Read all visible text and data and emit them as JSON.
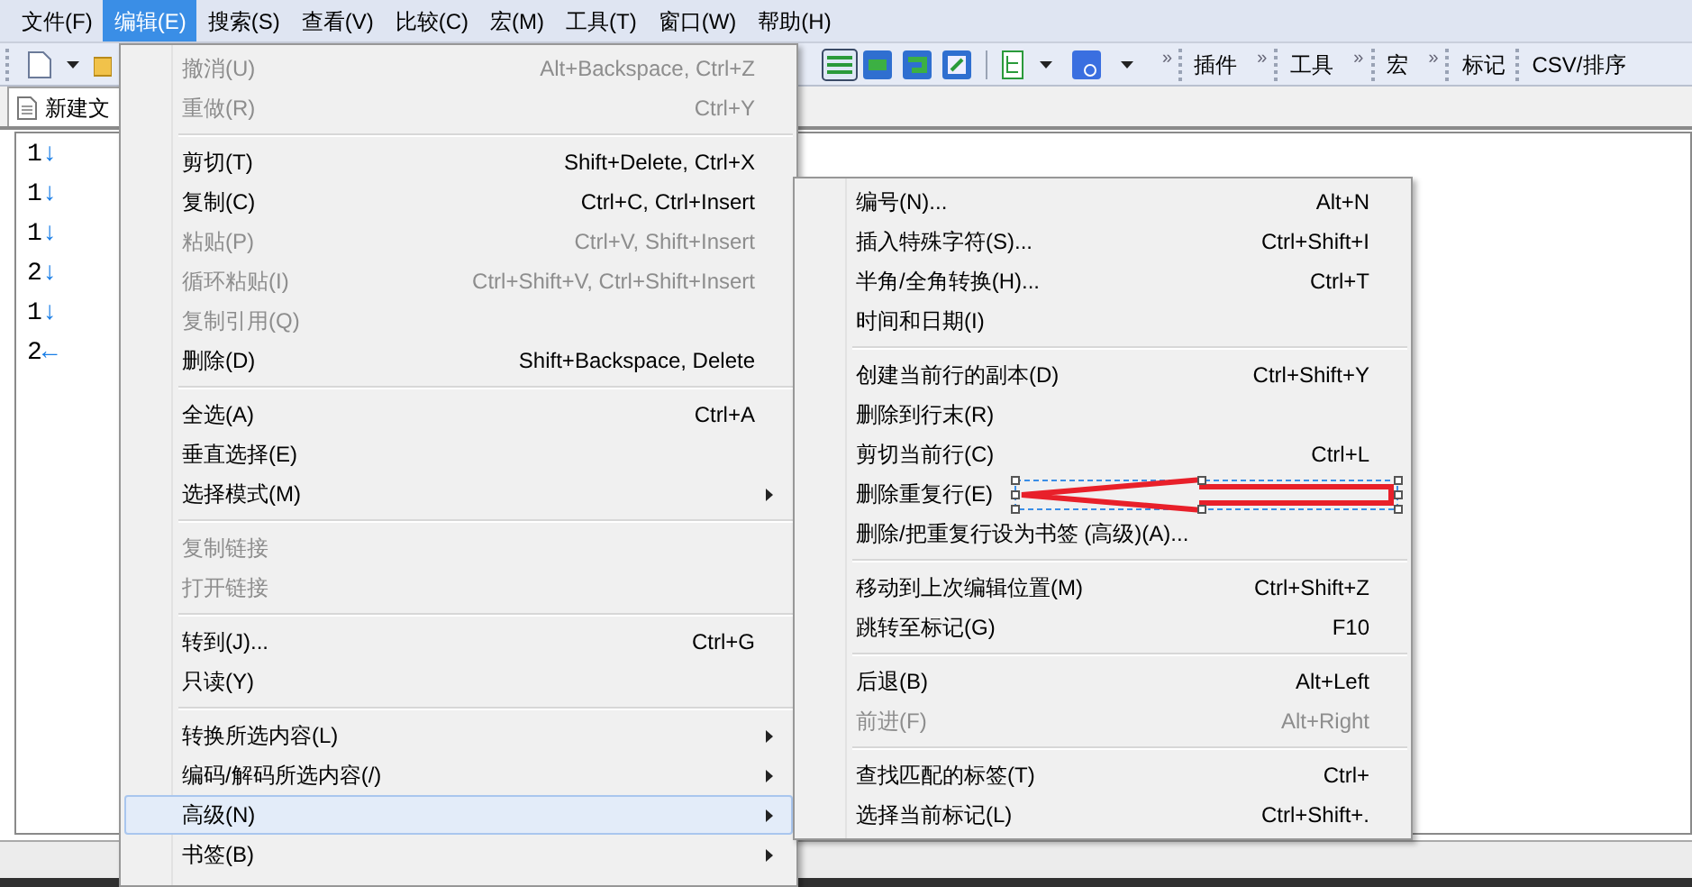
{
  "menubar": [
    {
      "label": "文件(F)",
      "selected": false
    },
    {
      "label": "编辑(E)",
      "selected": true
    },
    {
      "label": "搜索(S)",
      "selected": false
    },
    {
      "label": "查看(V)",
      "selected": false
    },
    {
      "label": "比较(C)",
      "selected": false
    },
    {
      "label": "宏(M)",
      "selected": false
    },
    {
      "label": "工具(T)",
      "selected": false
    },
    {
      "label": "窗口(W)",
      "selected": false
    },
    {
      "label": "帮助(H)",
      "selected": false
    }
  ],
  "toolbar": {
    "chevron": "»",
    "groups": [
      {
        "label": "插件",
        "chevron": "»"
      },
      {
        "label": "工具",
        "chevron": "»"
      },
      {
        "label": "宏",
        "chevron": "»"
      },
      {
        "label": "标记"
      },
      {
        "label": "CSV/排序"
      }
    ]
  },
  "tab": {
    "label": "新建文"
  },
  "editor_lines": [
    {
      "number": "1",
      "mark": "↓"
    },
    {
      "number": "1",
      "mark": "↓"
    },
    {
      "number": "1",
      "mark": "↓"
    },
    {
      "number": "2",
      "mark": "↓"
    },
    {
      "number": "1",
      "mark": "↓"
    },
    {
      "number": "2",
      "mark": "←"
    }
  ],
  "edit_menu": {
    "sections": [
      [
        {
          "label": "撤消(U)",
          "shortcut": "Alt+Backspace, Ctrl+Z",
          "disabled": true,
          "submenu": false,
          "selected": false
        },
        {
          "label": "重做(R)",
          "shortcut": "Ctrl+Y",
          "disabled": true,
          "submenu": false,
          "selected": false
        }
      ],
      [
        {
          "label": "剪切(T)",
          "shortcut": "Shift+Delete, Ctrl+X",
          "disabled": false,
          "submenu": false,
          "selected": false
        },
        {
          "label": "复制(C)",
          "shortcut": "Ctrl+C, Ctrl+Insert",
          "disabled": false,
          "submenu": false,
          "selected": false
        },
        {
          "label": "粘贴(P)",
          "shortcut": "Ctrl+V, Shift+Insert",
          "disabled": true,
          "submenu": false,
          "selected": false
        },
        {
          "label": "循环粘贴(I)",
          "shortcut": "Ctrl+Shift+V, Ctrl+Shift+Insert",
          "disabled": true,
          "submenu": false,
          "selected": false
        },
        {
          "label": "复制引用(Q)",
          "disabled": true,
          "submenu": false,
          "selected": false
        },
        {
          "label": "删除(D)",
          "shortcut": "Shift+Backspace, Delete",
          "disabled": false,
          "submenu": false,
          "selected": false
        }
      ],
      [
        {
          "label": "全选(A)",
          "shortcut": "Ctrl+A",
          "disabled": false,
          "submenu": false,
          "selected": false
        },
        {
          "label": "垂直选择(E)",
          "disabled": false,
          "submenu": false,
          "selected": false
        },
        {
          "label": "选择模式(M)",
          "disabled": false,
          "submenu": true,
          "selected": false
        }
      ],
      [
        {
          "label": "复制链接",
          "disabled": true,
          "submenu": false,
          "selected": false
        },
        {
          "label": "打开链接",
          "disabled": true,
          "submenu": false,
          "selected": false
        }
      ],
      [
        {
          "label": "转到(J)...",
          "shortcut": "Ctrl+G",
          "disabled": false,
          "submenu": false,
          "selected": false
        },
        {
          "label": "只读(Y)",
          "disabled": false,
          "submenu": false,
          "selected": false
        }
      ],
      [
        {
          "label": "转换所选内容(L)",
          "disabled": false,
          "submenu": true,
          "selected": false
        },
        {
          "label": "编码/解码所选内容(/)",
          "disabled": false,
          "submenu": true,
          "selected": false
        },
        {
          "label": "高级(N)",
          "disabled": false,
          "submenu": true,
          "selected": true
        },
        {
          "label": "书签(B)",
          "disabled": false,
          "submenu": true,
          "selected": false
        }
      ]
    ]
  },
  "advanced_menu": {
    "sections": [
      [
        {
          "label": "编号(N)...",
          "shortcut": "Alt+N",
          "disabled": false
        },
        {
          "label": "插入特殊字符(S)...",
          "shortcut": "Ctrl+Shift+I",
          "disabled": false
        },
        {
          "label": "半角/全角转换(H)...",
          "shortcut": "Ctrl+T",
          "disabled": false
        },
        {
          "label": "时间和日期(I)",
          "disabled": false
        }
      ],
      [
        {
          "label": "创建当前行的副本(D)",
          "shortcut": "Ctrl+Shift+Y",
          "disabled": false
        },
        {
          "label": "删除到行末(R)",
          "disabled": false
        },
        {
          "label": "剪切当前行(C)",
          "shortcut": "Ctrl+L",
          "disabled": false
        },
        {
          "label": "删除重复行(E)",
          "disabled": false
        },
        {
          "label": "删除/把重复行设为书签 (高级)(A)...",
          "disabled": false
        }
      ],
      [
        {
          "label": "移动到上次编辑位置(M)",
          "shortcut": "Ctrl+Shift+Z",
          "disabled": false
        },
        {
          "label": "跳转至标记(G)",
          "shortcut": "F10",
          "disabled": false
        }
      ],
      [
        {
          "label": "后退(B)",
          "shortcut": "Alt+Left",
          "disabled": false
        },
        {
          "label": "前进(F)",
          "shortcut": "Alt+Right",
          "disabled": true
        }
      ],
      [
        {
          "label": "查找匹配的标签(T)",
          "shortcut": "Ctrl+",
          "disabled": false
        },
        {
          "label": "选择当前标记(L)",
          "shortcut": "Ctrl+Shift+.",
          "disabled": false
        }
      ]
    ]
  }
}
